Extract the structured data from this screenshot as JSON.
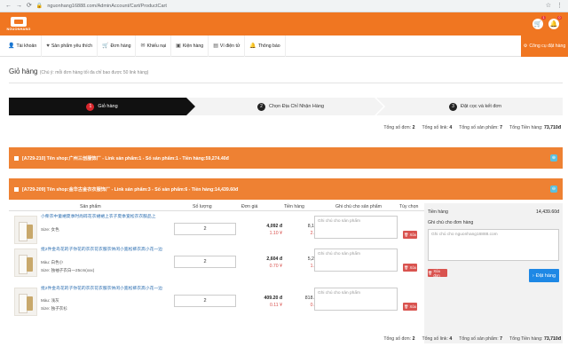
{
  "browser": {
    "url": "nguonhang16888.com/AdminAccount/Cart/ProductCart"
  },
  "brand": {
    "name": "NGUONHANG"
  },
  "header": {
    "badges": {
      "cart": "1",
      "bell": "0"
    }
  },
  "nav": {
    "items": [
      {
        "label": "Tài khoản",
        "icon": "user-icon"
      },
      {
        "label": "Sản phẩm yêu thích",
        "icon": "heart-icon"
      },
      {
        "label": "Đơn hàng",
        "icon": "cart-icon"
      },
      {
        "label": "Khiếu nại",
        "icon": "chat-icon"
      },
      {
        "label": "Kiện hàng",
        "icon": "box-icon"
      },
      {
        "label": "Ví điện tử",
        "icon": "wallet-icon"
      },
      {
        "label": "Thông báo",
        "icon": "bell-icon"
      }
    ],
    "tool_label": "Công cụ đặt hàng"
  },
  "page": {
    "title": "Giỏ hàng",
    "subtitle": "(Chú ý: mỗi đơn hàng tối đa chỉ bao được 50 link hàng)"
  },
  "steps": [
    {
      "num": "1",
      "label": "Giỏ hàng"
    },
    {
      "num": "2",
      "label": "Chọn Địa Chỉ Nhận Hàng"
    },
    {
      "num": "3",
      "label": "Đặt cọc và kết đơn"
    }
  ],
  "summary": {
    "shops_label": "Tổng số đơn:",
    "shops": "2",
    "links_label": "Tổng số link:",
    "links": "4",
    "products_label": "Tổng số sản phẩm:",
    "products": "7",
    "total_label": "Tổng Tiền hàng:",
    "total": "73,710đ"
  },
  "shops": [
    {
      "text": "[A729-210] Tên shop:广州三创服饰厂 - Link sản phẩm:1 - Số sản phẩm:1 - Tiền hàng:59,274.40đ"
    },
    {
      "text": "[A729-209] Tên shop:金华古金衣衣服饰厂 - Link sản phẩm:3 - Số sản phẩm:6 - Tiền hàng:14,439.60đ"
    }
  ],
  "table": {
    "headers": {
      "product": "Sản phẩm",
      "qty": "Số lượng",
      "price": "Đơn giá",
      "amount": "Tiền hàng",
      "note": "Ghi chú cho sản phẩm",
      "action": "Tùy chọn"
    },
    "note_placeholder": "Ghi chú cho sản phẩm",
    "delete_label": "Xóa",
    "rows": [
      {
        "name": "小柴衣中童裙夏季时尚碎花衣裙裙上衣子夏季宽松衣衣服品上",
        "meta1": "Size: 女色",
        "meta2": "",
        "qty": "2",
        "price_vnd": "4,092 đ",
        "price_cny": "1.10 ¥",
        "amount_vnd": "8,184 đ",
        "amount_cny": "2.20 ¥"
      },
      {
        "name": "批2件金鸟花的子你花的衣衣花衣服衣休闲小宽松裤衣高小花一边",
        "meta1": "Màu: 白色小",
        "meta2": "Size: 独袖子衣白一25cm(xxx)",
        "qty": "2",
        "price_vnd": "2,604 đ",
        "price_cny": "0.70 ¥",
        "amount_vnd": "5,208 đ",
        "amount_cny": "1.40 ¥"
      },
      {
        "name": "批2件金鸟花的子你花的衣衣花衣服衣休闲小宽松裤衣高小花一边",
        "meta1": "Màu: 浅灰",
        "meta2": "Size: 独子衣衫",
        "qty": "2",
        "price_vnd": "409.20 đ",
        "price_cny": "0.11 ¥",
        "amount_vnd": "818.40 đ",
        "amount_cny": "0.22 ¥"
      }
    ]
  },
  "sidebar": {
    "money_label": "Tiền hàng",
    "money_value": "14,439.60đ",
    "note_label": "Ghi chú cho đơn hàng",
    "note_placeholder": "Ghi chú cho nguonhang16888.com",
    "delete_label": "Xóa đơn",
    "order_label": "Đặt hàng"
  }
}
